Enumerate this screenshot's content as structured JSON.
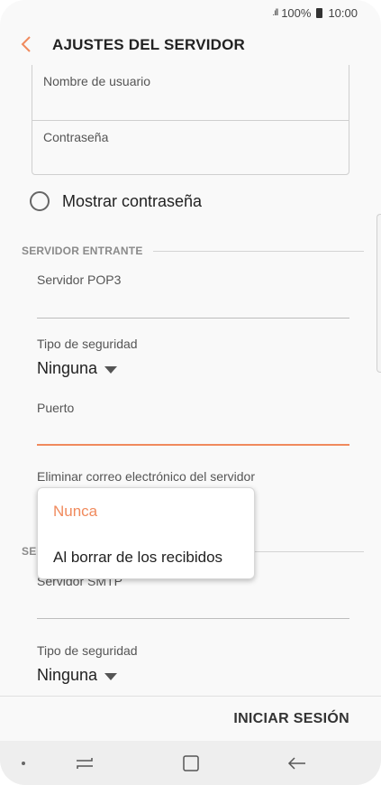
{
  "status_bar": {
    "signal": ".ıll",
    "battery": "100%",
    "time": "10:00"
  },
  "header": {
    "title": "AJUSTES DEL SERVIDOR"
  },
  "account_fields": {
    "username_label": "Nombre de usuario",
    "password_label": "Contraseña"
  },
  "show_password": {
    "label": "Mostrar contraseña",
    "checked": false
  },
  "incoming": {
    "section_title": "SERVIDOR ENTRANTE",
    "server_label": "Servidor POP3",
    "server_value": "",
    "security_label": "Tipo de seguridad",
    "security_value": "Ninguna",
    "port_label": "Puerto",
    "port_value": "",
    "delete_label": "Eliminar correo electrónico del servidor"
  },
  "outgoing": {
    "section_title_partial": "SE",
    "server_label": "Servidor SMTP",
    "security_label": "Tipo de seguridad",
    "security_value": "Ninguna"
  },
  "dropdown": {
    "options": [
      "Nunca",
      "Al borrar de los recibidos"
    ],
    "selected": "Nunca"
  },
  "footer": {
    "login_button": "INICIAR SESIÓN"
  },
  "colors": {
    "accent": "#f08a5d",
    "text": "#222222",
    "muted": "#8a8a8a"
  },
  "icons": {
    "back": "chevron-left-icon",
    "recent": "recent-apps-icon",
    "home": "home-icon",
    "back_nav": "back-arrow-icon"
  }
}
